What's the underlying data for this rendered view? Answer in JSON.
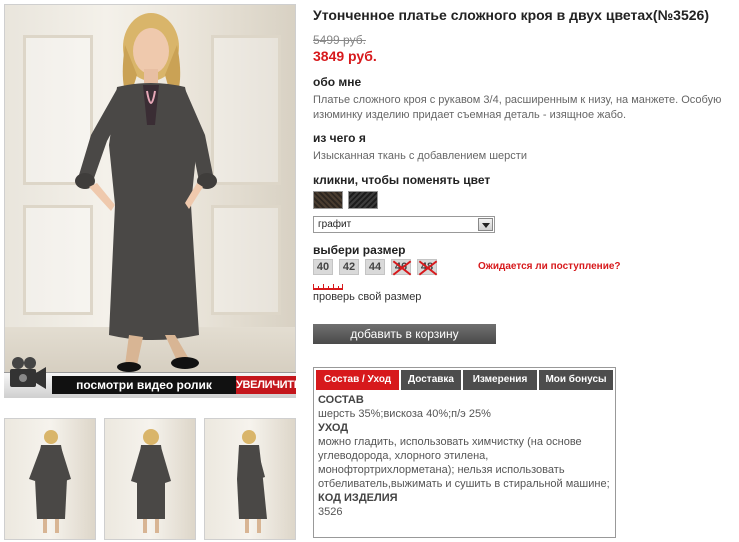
{
  "product": {
    "title": "Утонченное платье сложного кроя в двух цветах(№3526)",
    "old_price": "5499 руб.",
    "new_price": "3849 руб."
  },
  "media": {
    "video_label": "посмотри видео ролик",
    "zoom_label": "УВЕЛИЧИТЬ"
  },
  "about": {
    "heading": "обо мне",
    "text": "Платье сложного кроя с рукавом 3/4, расширенным к низу, на манжете. Особую изюминку изделию придает съемная деталь - изящное жабо."
  },
  "material": {
    "heading": "из чего я",
    "text": "Изысканная ткань с добавлением шерсти"
  },
  "color": {
    "heading": "кликни, чтобы поменять цвет",
    "selected": "графит"
  },
  "size": {
    "heading": "выбери размер",
    "options": [
      "40",
      "42",
      "44",
      "46",
      "48"
    ],
    "restock_link": "Ожидается ли поступление?",
    "check_link": "проверь свой размер"
  },
  "cart": {
    "button_label": "добавить в корзину"
  },
  "tabs": {
    "labels": [
      "Состав / Уход",
      "Доставка",
      "Измерения",
      "Мои бонусы"
    ],
    "content": {
      "composition_heading": "СОСТАВ",
      "composition_text": "шерсть 35%;вискоза 40%;п/э 25%",
      "care_heading": "УХОД",
      "care_text": "можно гладить, использовать химчистку (на основе углеводорода, хлорного этилена, монофтортрихлорметана); нельзя использовать отбеливатель,выжимать и сушить в стиральной машине;",
      "code_heading": "КОД ИЗДЕЛИЯ",
      "code_value": "3526"
    }
  },
  "colors": {
    "accent_red": "#d7191c",
    "dark_button": "#4d4d4d"
  }
}
